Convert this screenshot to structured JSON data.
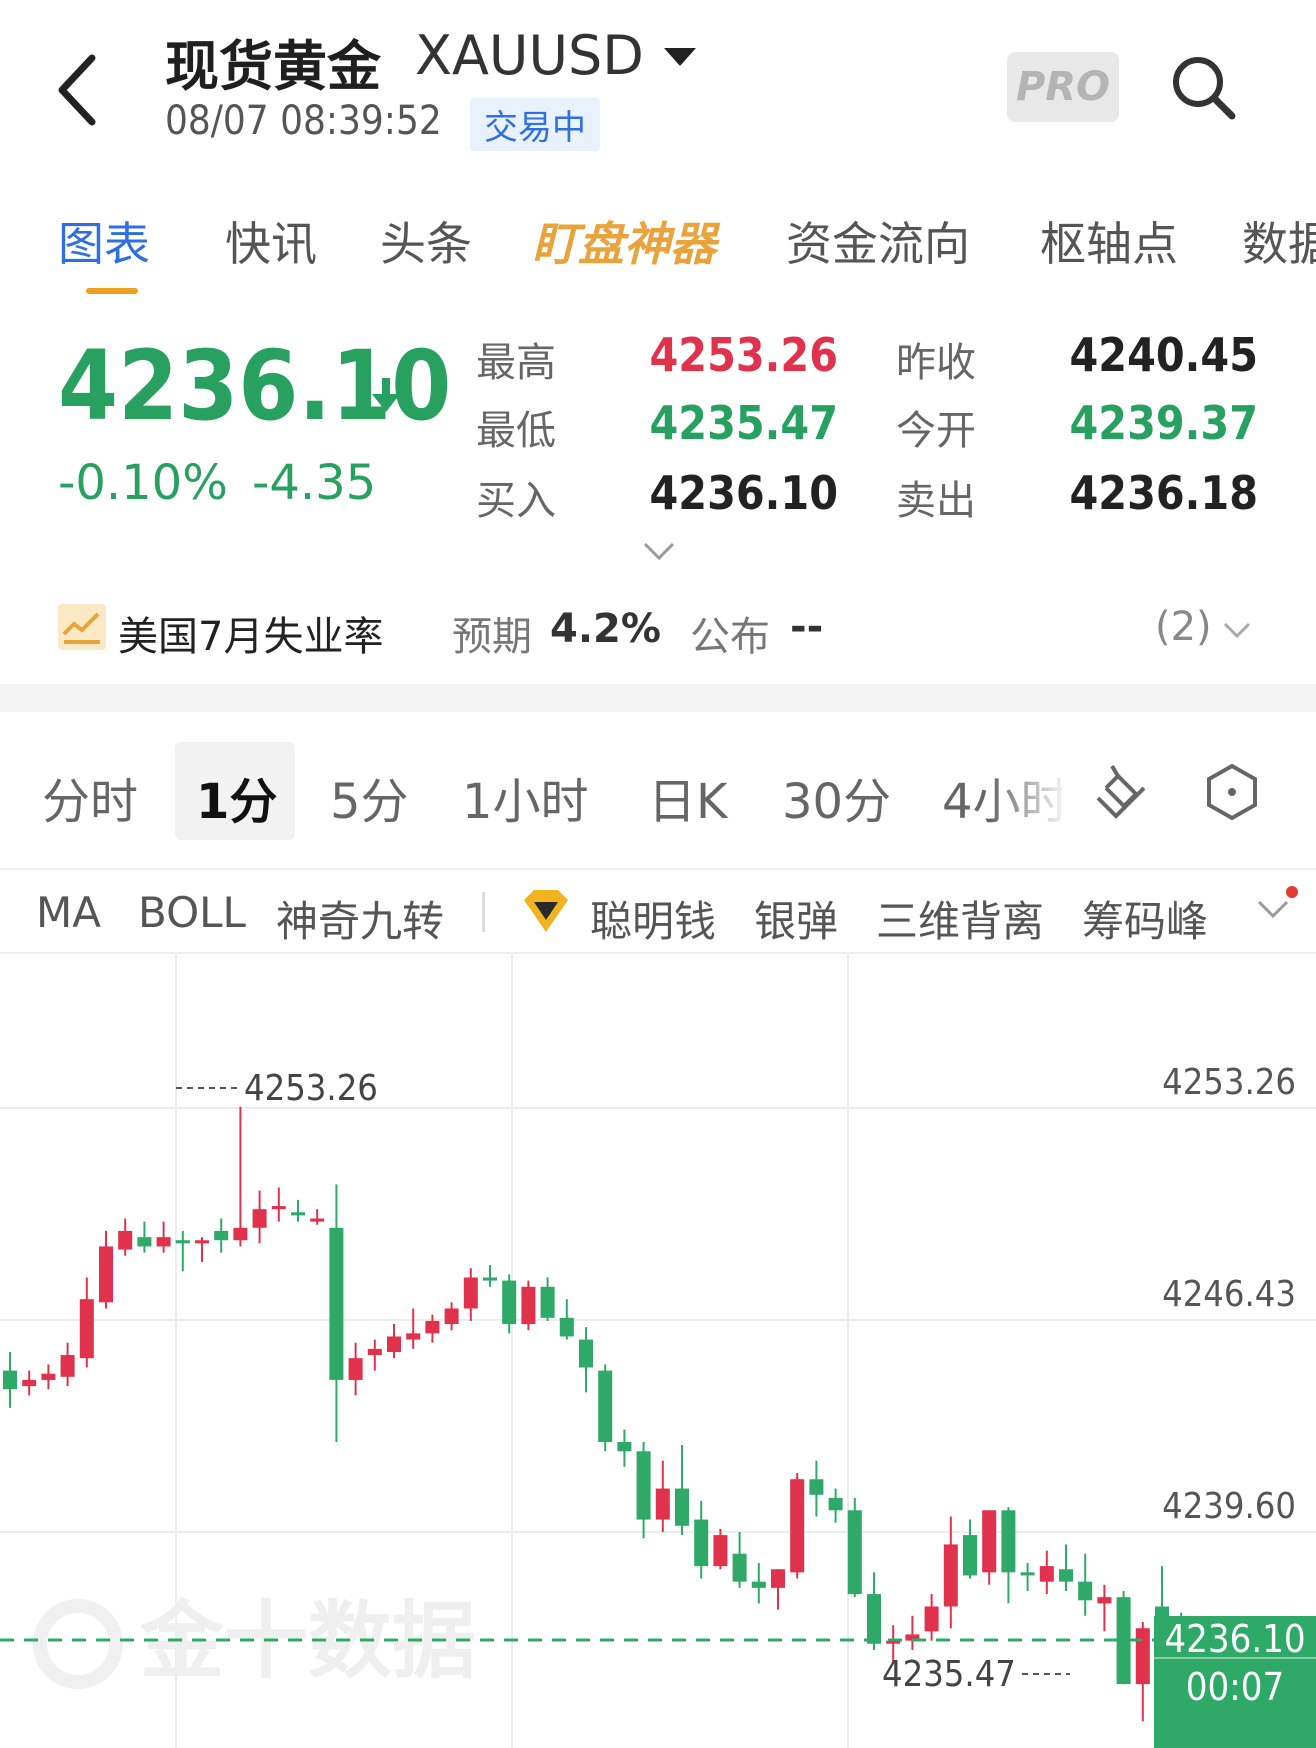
{
  "header": {
    "title": "现货黄金",
    "symbol": "XAUUSD",
    "timestamp": "08/07 08:39:52",
    "status": "交易中",
    "pro_label": "PRO"
  },
  "tabs": [
    {
      "label": "图表",
      "active": true
    },
    {
      "label": "快讯"
    },
    {
      "label": "头条"
    },
    {
      "label": "盯盘神器",
      "highlight": true
    },
    {
      "label": "资金流向"
    },
    {
      "label": "枢轴点"
    },
    {
      "label": "数据"
    }
  ],
  "quote": {
    "last": "4236.10",
    "change_pct": "-0.10%",
    "change": "-4.35",
    "high_label": "最高",
    "high": "4253.26",
    "low_label": "最低",
    "low": "4235.47",
    "bid_label": "买入",
    "bid": "4236.10",
    "prev_close_label": "昨收",
    "prev_close": "4240.45",
    "open_label": "今开",
    "open": "4239.37",
    "ask_label": "卖出",
    "ask": "4236.18"
  },
  "event": {
    "title": "美国7月失业率",
    "forecast_label": "预期",
    "forecast": "4.2%",
    "publish_label": "公布",
    "publish": "--",
    "count": "(2)"
  },
  "periods": [
    {
      "label": "分时"
    },
    {
      "label": "1分",
      "active": true
    },
    {
      "label": "5分"
    },
    {
      "label": "1小时"
    },
    {
      "label": "日K"
    },
    {
      "label": "30分"
    },
    {
      "label": "4小时"
    }
  ],
  "indicators": [
    "MA",
    "BOLL",
    "神奇九转",
    "聪明钱",
    "银弹",
    "三维背离",
    "筹码峰"
  ],
  "colors": {
    "up": "#e0324c",
    "down": "#2fa968",
    "blue": "#2f6fe0",
    "gold": "#e8a33c"
  },
  "chart_data": {
    "type": "candlestick",
    "y_ticks": [
      "4253.26",
      "4246.43",
      "4239.60"
    ],
    "high_label": "4253.26",
    "low_label": "4235.47",
    "last_price_label": "4236.10",
    "countdown": "00:07",
    "watermark": "金十数据",
    "ylim": [
      4233.0,
      4258.0
    ],
    "candles": [
      [
        4244.8,
        4245.4,
        4243.6,
        4244.2
      ],
      [
        4244.3,
        4244.8,
        4244.0,
        4244.5
      ],
      [
        4244.5,
        4245.0,
        4244.2,
        4244.7
      ],
      [
        4244.6,
        4245.7,
        4244.3,
        4245.3
      ],
      [
        4245.2,
        4247.8,
        4244.9,
        4247.1
      ],
      [
        4247.0,
        4249.3,
        4246.8,
        4248.8
      ],
      [
        4248.7,
        4249.7,
        4248.5,
        4249.3
      ],
      [
        4249.1,
        4249.6,
        4248.6,
        4248.8
      ],
      [
        4248.8,
        4249.6,
        4248.6,
        4249.1
      ],
      [
        4249.0,
        4249.3,
        4248.0,
        4248.9
      ],
      [
        4248.9,
        4249.1,
        4248.3,
        4249.0
      ],
      [
        4249.3,
        4249.7,
        4248.6,
        4249.0
      ],
      [
        4249.0,
        4253.3,
        4248.8,
        4249.4
      ],
      [
        4249.4,
        4250.6,
        4248.9,
        4250.0
      ],
      [
        4250.0,
        4250.7,
        4249.6,
        4250.1
      ],
      [
        4249.9,
        4250.3,
        4249.6,
        4249.8
      ],
      [
        4249.6,
        4250.0,
        4249.5,
        4249.7
      ],
      [
        4249.4,
        4250.8,
        4242.5,
        4244.5
      ],
      [
        4244.5,
        4245.7,
        4244.0,
        4245.2
      ],
      [
        4245.3,
        4245.8,
        4244.8,
        4245.5
      ],
      [
        4245.4,
        4246.3,
        4245.2,
        4245.9
      ],
      [
        4245.8,
        4246.8,
        4245.5,
        4246.0
      ],
      [
        4246.0,
        4246.6,
        4245.7,
        4246.4
      ],
      [
        4246.3,
        4247.0,
        4246.1,
        4246.8
      ],
      [
        4246.8,
        4248.1,
        4246.4,
        4247.8
      ],
      [
        4247.8,
        4248.2,
        4247.5,
        4247.7
      ],
      [
        4247.7,
        4247.9,
        4246.0,
        4246.3
      ],
      [
        4246.3,
        4247.7,
        4246.1,
        4247.5
      ],
      [
        4247.5,
        4247.8,
        4246.4,
        4246.5
      ],
      [
        4246.5,
        4247.1,
        4245.8,
        4245.9
      ],
      [
        4245.8,
        4246.2,
        4244.1,
        4244.9
      ],
      [
        4244.8,
        4245.0,
        4242.2,
        4242.5
      ],
      [
        4242.5,
        4242.9,
        4241.7,
        4242.2
      ],
      [
        4242.2,
        4242.5,
        4239.4,
        4240.0
      ],
      [
        4240.0,
        4241.9,
        4239.6,
        4241.0
      ],
      [
        4241.0,
        4242.4,
        4239.5,
        4239.8
      ],
      [
        4240.0,
        4240.6,
        4238.1,
        4238.5
      ],
      [
        4238.5,
        4239.7,
        4238.4,
        4239.5
      ],
      [
        4238.9,
        4239.6,
        4237.8,
        4238.0
      ],
      [
        4238.0,
        4238.6,
        4237.3,
        4237.8
      ],
      [
        4237.8,
        4238.4,
        4237.1,
        4238.4
      ],
      [
        4238.3,
        4241.5,
        4238.1,
        4241.3
      ],
      [
        4241.3,
        4241.9,
        4240.1,
        4240.8
      ],
      [
        4240.7,
        4241.0,
        4239.9,
        4240.3
      ],
      [
        4240.3,
        4240.7,
        4237.5,
        4237.6
      ],
      [
        4237.6,
        4238.3,
        4235.8,
        4236.0
      ],
      [
        4236.0,
        4236.6,
        4235.4,
        4236.1
      ],
      [
        4236.1,
        4236.9,
        4235.8,
        4236.3
      ],
      [
        4236.4,
        4237.6,
        4236.1,
        4237.2
      ],
      [
        4237.2,
        4240.1,
        4236.5,
        4239.2
      ],
      [
        4239.5,
        4240.0,
        4238.1,
        4238.2
      ],
      [
        4238.3,
        4240.3,
        4237.9,
        4240.3
      ],
      [
        4240.3,
        4240.4,
        4237.3,
        4238.3
      ],
      [
        4238.3,
        4238.6,
        4237.7,
        4238.2
      ],
      [
        4238.0,
        4239.0,
        4237.6,
        4238.5
      ],
      [
        4238.4,
        4239.2,
        4237.7,
        4238.0
      ],
      [
        4238.0,
        4238.9,
        4236.9,
        4237.4
      ],
      [
        4237.3,
        4237.9,
        4236.4,
        4237.5
      ],
      [
        4237.5,
        4237.7,
        4234.7,
        4234.7
      ],
      [
        4234.7,
        4236.7,
        4233.5,
        4236.5
      ],
      [
        4237.2,
        4238.5,
        4235.8,
        4236.6
      ],
      [
        4236.0,
        4237.0,
        4232.4,
        4235.9
      ],
      [
        4236.3,
        4236.6,
        4234.6,
        4236.1
      ]
    ]
  }
}
